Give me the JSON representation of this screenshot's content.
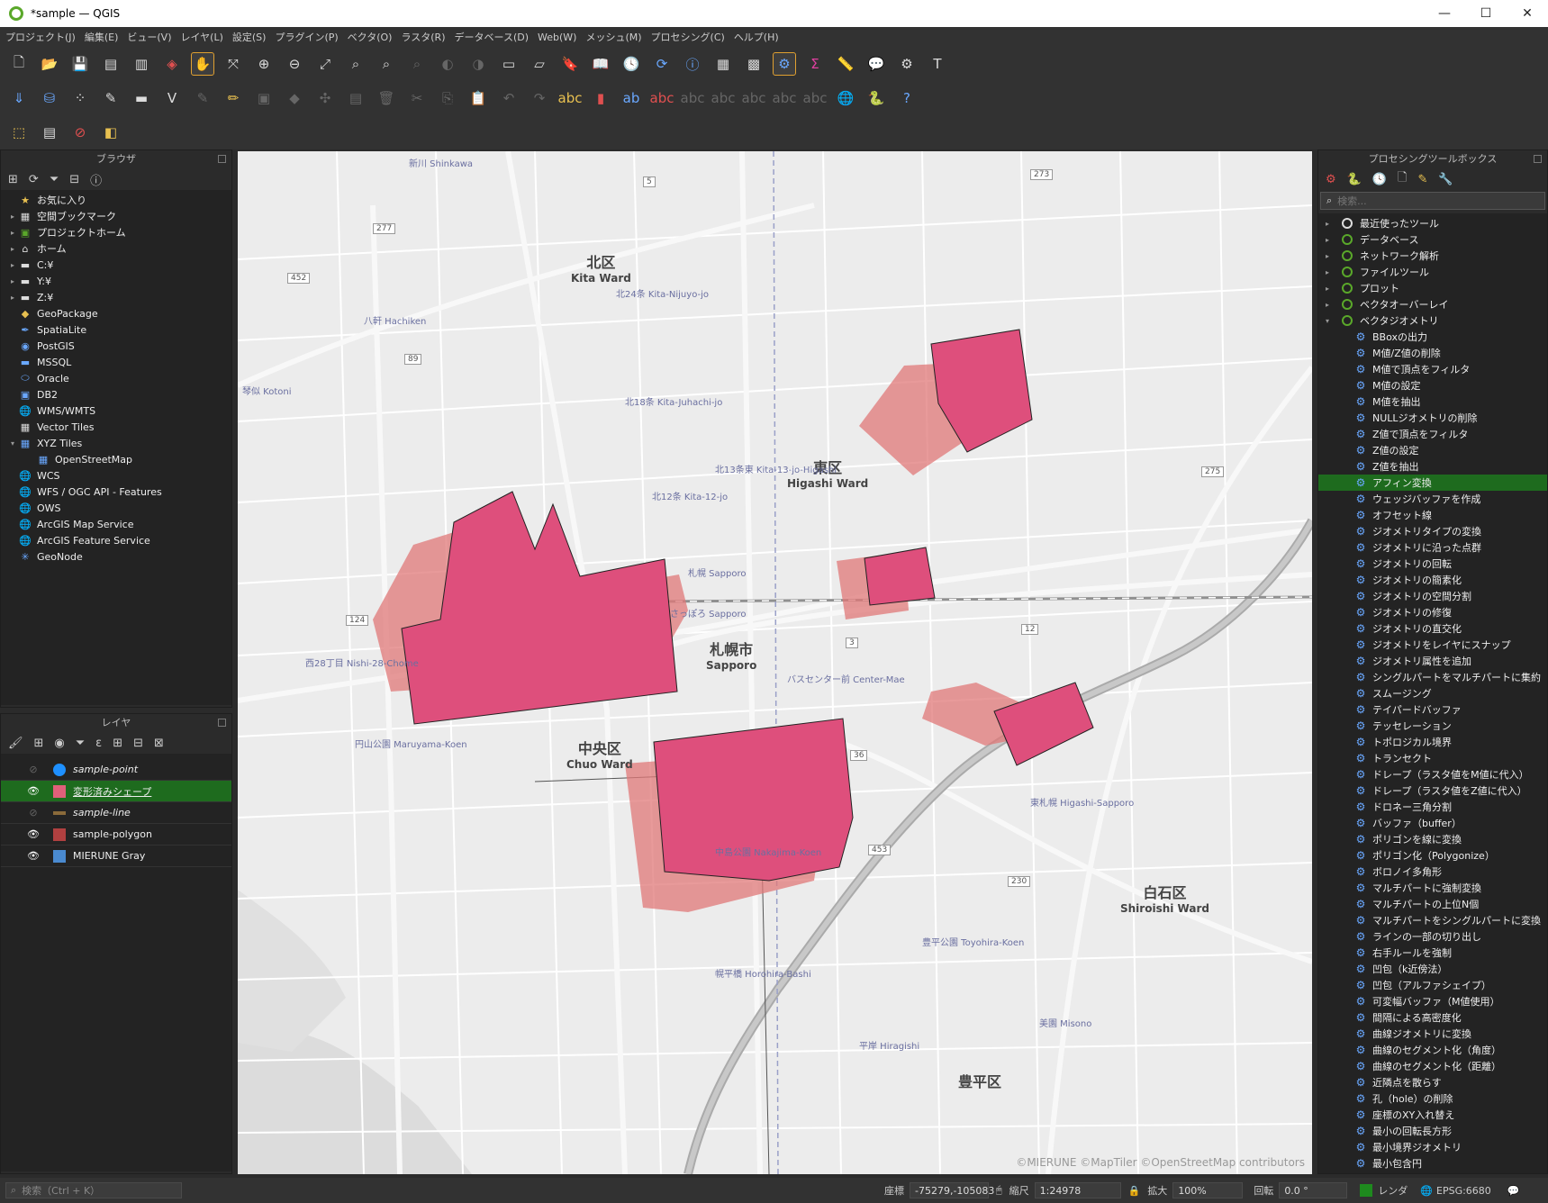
{
  "window": {
    "title": "*sample — QGIS"
  },
  "menu": [
    "プロジェクト(J)",
    "編集(E)",
    "ビュー(V)",
    "レイヤ(L)",
    "設定(S)",
    "プラグイン(P)",
    "ベクタ(O)",
    "ラスタ(R)",
    "データベース(D)",
    "Web(W)",
    "メッシュ(M)",
    "プロセシング(C)",
    "ヘルプ(H)"
  ],
  "browser": {
    "title": "ブラウザ",
    "items": [
      {
        "label": "お気に入り",
        "icon": "star-icon",
        "arrow": "",
        "indent": 0
      },
      {
        "label": "空間ブックマーク",
        "icon": "bookmark-icon",
        "arrow": "▸",
        "indent": 0
      },
      {
        "label": "プロジェクトホーム",
        "icon": "project-home-icon",
        "arrow": "▸",
        "indent": 0
      },
      {
        "label": "ホーム",
        "icon": "home-icon",
        "arrow": "▸",
        "indent": 0
      },
      {
        "label": "C:¥",
        "icon": "folder-icon",
        "arrow": "▸",
        "indent": 0
      },
      {
        "label": "Y:¥",
        "icon": "folder-icon",
        "arrow": "▸",
        "indent": 0
      },
      {
        "label": "Z:¥",
        "icon": "folder-icon",
        "arrow": "▸",
        "indent": 0
      },
      {
        "label": "GeoPackage",
        "icon": "geopackage-icon",
        "arrow": "",
        "indent": 0
      },
      {
        "label": "SpatiaLite",
        "icon": "spatialite-icon",
        "arrow": "",
        "indent": 0
      },
      {
        "label": "PostGIS",
        "icon": "postgis-icon",
        "arrow": "",
        "indent": 0
      },
      {
        "label": "MSSQL",
        "icon": "mssql-icon",
        "arrow": "",
        "indent": 0
      },
      {
        "label": "Oracle",
        "icon": "oracle-icon",
        "arrow": "",
        "indent": 0
      },
      {
        "label": "DB2",
        "icon": "db2-icon",
        "arrow": "",
        "indent": 0
      },
      {
        "label": "WMS/WMTS",
        "icon": "wms-icon",
        "arrow": "",
        "indent": 0
      },
      {
        "label": "Vector Tiles",
        "icon": "vector-tiles-icon",
        "arrow": "",
        "indent": 0
      },
      {
        "label": "XYZ Tiles",
        "icon": "xyz-tiles-icon",
        "arrow": "▾",
        "indent": 0
      },
      {
        "label": "OpenStreetMap",
        "icon": "xyz-tiles-icon",
        "arrow": "",
        "indent": 1
      },
      {
        "label": "WCS",
        "icon": "wcs-icon",
        "arrow": "",
        "indent": 0
      },
      {
        "label": "WFS / OGC API - Features",
        "icon": "wfs-icon",
        "arrow": "",
        "indent": 0
      },
      {
        "label": "OWS",
        "icon": "ows-icon",
        "arrow": "",
        "indent": 0
      },
      {
        "label": "ArcGIS Map Service",
        "icon": "arcgis-icon",
        "arrow": "",
        "indent": 0
      },
      {
        "label": "ArcGIS Feature Service",
        "icon": "arcgis-icon",
        "arrow": "",
        "indent": 0
      },
      {
        "label": "GeoNode",
        "icon": "geonode-icon",
        "arrow": "",
        "indent": 0
      }
    ]
  },
  "layers": {
    "title": "レイヤ",
    "items": [
      {
        "label": "sample-point",
        "visible": false,
        "selected": false,
        "italic": true,
        "color": "#1e90ff"
      },
      {
        "label": "変形済みシェープ",
        "visible": true,
        "selected": true,
        "italic": false,
        "color": "#e0607a"
      },
      {
        "label": "sample-line",
        "visible": false,
        "selected": false,
        "italic": true,
        "color": "#8a6a3a"
      },
      {
        "label": "sample-polygon",
        "visible": true,
        "selected": false,
        "italic": false,
        "color": "#b04040"
      },
      {
        "label": "MIERUNE Gray",
        "visible": true,
        "selected": false,
        "italic": false,
        "color": "#4a8ad0"
      }
    ]
  },
  "map": {
    "attribution": "©MIERUNE ©MapTiler ©OpenStreetMap contributors",
    "labels": [
      {
        "text": "北区",
        "sub": "Kita Ward"
      },
      {
        "text": "東区",
        "sub": "Higashi Ward"
      },
      {
        "text": "札幌市",
        "sub": "Sapporo"
      },
      {
        "text": "中央区",
        "sub": "Chuo Ward"
      },
      {
        "text": "白石区",
        "sub": "Shiroishi Ward"
      },
      {
        "text": "豊平区",
        "sub": ""
      }
    ],
    "stations": [
      "新川 Shinkawa",
      "八軒 Hachiken",
      "琴似 Kotoni",
      "北24条 Kita-Nijuyo-jo",
      "北18条 Kita-Juhachi-jo",
      "北12条 Kita-12-jo",
      "北13条東 Kita-13-jo-Higashi",
      "さっぽろ Sapporo",
      "西28丁目 Nishi-28-Chome",
      "円山公園 Maruyama-Koen",
      "バスセンター前 Center-Mae",
      "中島公園 Nakajima-Koen",
      "東札幌 Higashi-Sapporo",
      "豊平公園 Toyohira-Koen",
      "幌平橋 Horohira-Bashi",
      "平岸 Hiragishi",
      "美園 Misono",
      "札幌 Sapporo"
    ],
    "route_numbers": [
      "5",
      "277",
      "452",
      "89",
      "124",
      "12",
      "275",
      "273",
      "3",
      "36",
      "453",
      "230"
    ]
  },
  "processing": {
    "title": "プロセシングツールボックス",
    "search_placeholder": "検索...",
    "groups": [
      "最近使ったツール",
      "データベース",
      "ネットワーク解析",
      "ファイルツール",
      "プロット",
      "ベクタオーバーレイ",
      "ベクタジオメトリ"
    ],
    "tools": [
      "BBoxの出力",
      "M値/Z値の削除",
      "M値で頂点をフィルタ",
      "M値の設定",
      "M値を抽出",
      "NULLジオメトリの削除",
      "Z値で頂点をフィルタ",
      "Z値の設定",
      "Z値を抽出",
      "アフィン変換",
      "ウェッジバッファを作成",
      "オフセット線",
      "ジオメトリタイプの変換",
      "ジオメトリに沿った点群",
      "ジオメトリの回転",
      "ジオメトリの簡素化",
      "ジオメトリの空間分割",
      "ジオメトリの修復",
      "ジオメトリの直交化",
      "ジオメトリをレイヤにスナップ",
      "ジオメトリ属性を追加",
      "シングルパートをマルチパートに集約",
      "スムージング",
      "テイパードバッファ",
      "テッセレーション",
      "トポロジカル境界",
      "トランセクト",
      "ドレープ（ラスタ値をM値に代入）",
      "ドレープ（ラスタ値をZ値に代入）",
      "ドロネー三角分割",
      "バッファ（buffer）",
      "ポリゴンを線に変換",
      "ポリゴン化（Polygonize）",
      "ボロノイ多角形",
      "マルチパートに強制変換",
      "マルチパートの上位N個",
      "マルチパートをシングルパートに変換",
      "ラインの一部の切り出し",
      "右手ルールを強制",
      "凹包（k近傍法）",
      "凹包（アルファシェイプ）",
      "可変幅バッファ（M値使用）",
      "間隔による高密度化",
      "曲線ジオメトリに変換",
      "曲線のセグメント化（角度）",
      "曲線のセグメント化（距離）",
      "近隣点を散らす",
      "孔（hole）の削除",
      "座標のXY入れ替え",
      "最小の回転長方形",
      "最小境界ジオメトリ",
      "最小包含円"
    ],
    "selected_tool": "アフィン変換"
  },
  "status": {
    "search_placeholder": "検索（Ctrl + K）",
    "coord_label": "座標",
    "coord_value": "-75279,-105083",
    "scale_label": "縮尺",
    "scale_value": "1:24978",
    "magnifier_label": "拡大",
    "magnifier_value": "100%",
    "rotation_label": "回転",
    "rotation_value": "0.0 °",
    "render_label": "レンダ",
    "crs": "EPSG:6680"
  }
}
